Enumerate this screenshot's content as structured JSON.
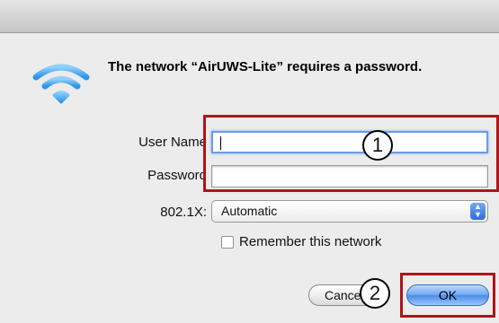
{
  "dialog": {
    "message": "The network “AirUWS-Lite” requires a password."
  },
  "form": {
    "user_name_label": "User Name",
    "user_name_value": "",
    "password_label": "Password",
    "password_value": "",
    "security_label": "802.1X:",
    "security_selected": "Automatic",
    "remember_label": "Remember this network",
    "remember_checked": false
  },
  "buttons": {
    "cancel_label": "Cancel",
    "ok_label": "OK"
  },
  "annotations": {
    "callout_1": "1",
    "callout_2": "2",
    "color": "#b0131b"
  },
  "icons": {
    "network": "wifi-icon",
    "select_arrows": "updown-arrows-icon"
  },
  "colors": {
    "focus_ring": "#6d9be6",
    "default_button": "#4a8be6"
  }
}
